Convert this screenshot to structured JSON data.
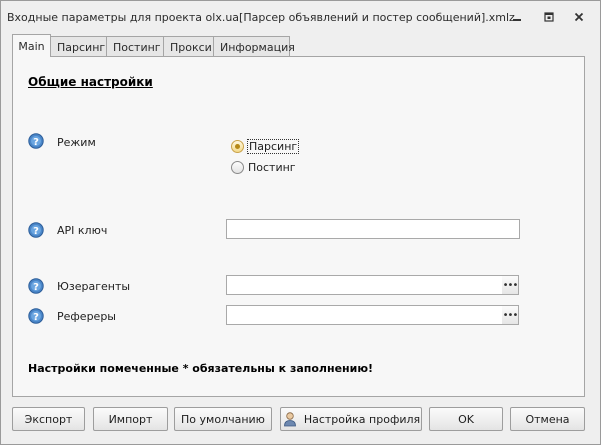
{
  "window": {
    "title": "Входные параметры для проекта olx.ua[Парсер объявлений и постер сообщений].xmlz"
  },
  "tabs": [
    {
      "label": "Main"
    },
    {
      "label": "Парсинг"
    },
    {
      "label": "Постинг"
    },
    {
      "label": "Прокси"
    },
    {
      "label": "Информация"
    }
  ],
  "active_tab": "Main",
  "main": {
    "section_title": "Общие настройки",
    "mode": {
      "label": "Режим",
      "options": [
        {
          "label": "Парсинг",
          "checked": true
        },
        {
          "label": "Постинг",
          "checked": false
        }
      ]
    },
    "api_key": {
      "label": "API ключ",
      "value": ""
    },
    "useragents": {
      "label": "Юзерагенты",
      "value": ""
    },
    "referers": {
      "label": "Рефереры",
      "value": ""
    },
    "required_note": "Настройки помеченные * обязательны к заполнению!"
  },
  "buttons": {
    "export": "Экспорт",
    "import": "Импорт",
    "default": "По умолчанию",
    "profile": "Настройка профиля",
    "ok": "OK",
    "cancel": "Отмена"
  },
  "icons": {
    "help": "help-question-icon",
    "profile": "user-profile-icon",
    "minimize": "minimize-icon",
    "maximize": "maximize-icon",
    "close": "close-icon"
  },
  "colors": {
    "help_icon": "#3a6fb0",
    "radio_checked": "#f3d98a"
  }
}
